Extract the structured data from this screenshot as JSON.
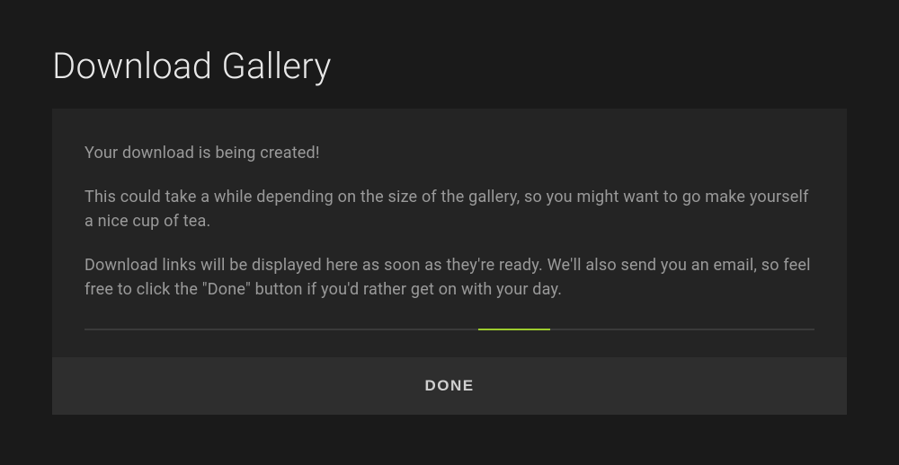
{
  "header": {
    "title": "Download Gallery"
  },
  "panel": {
    "paragraphs": [
      "Your download is being created!",
      "This could take a while depending on the size of the gallery, so you might want to go make yourself a nice cup of tea.",
      "Download links will be displayed here as soon as they're ready. We'll also send you an email, so feel free to click the \"Done\" button if you'd rather get on with your day."
    ]
  },
  "progress": {
    "accent_color": "#9ccc2e"
  },
  "actions": {
    "done_label": "DONE"
  }
}
